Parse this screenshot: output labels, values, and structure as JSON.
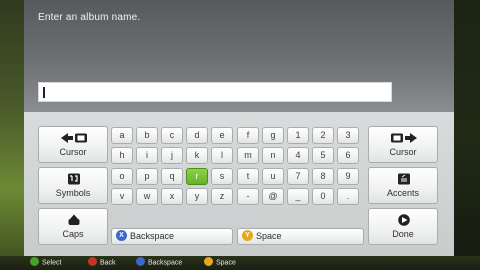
{
  "dialog": {
    "prompt": "Enter an album name.",
    "input_value": ""
  },
  "keyboard": {
    "rows": [
      [
        "a",
        "b",
        "c",
        "d",
        "e",
        "f",
        "g",
        "1",
        "2",
        "3"
      ],
      [
        "h",
        "i",
        "j",
        "k",
        "l",
        "m",
        "n",
        "4",
        "5",
        "6"
      ],
      [
        "o",
        "p",
        "q",
        "r",
        "s",
        "t",
        "u",
        "7",
        "8",
        "9"
      ],
      [
        "v",
        "w",
        "x",
        "y",
        "z",
        "-",
        "@",
        "_",
        "0",
        "."
      ]
    ],
    "selected_key": "r",
    "left_keys": {
      "cursor_left": "Cursor",
      "symbols": "Symbols",
      "caps": "Caps"
    },
    "right_keys": {
      "cursor_right": "Cursor",
      "accents": "Accents",
      "done": "Done"
    },
    "backspace": {
      "badge": "X",
      "label": "Backspace"
    },
    "space": {
      "badge": "Y",
      "label": "Space"
    }
  },
  "colors": {
    "selected_key": "#64b32a",
    "x_button": "#3a68c8",
    "y_button": "#e6a81c",
    "a_button": "#49a12b",
    "b_button": "#c63424"
  },
  "legend": {
    "select": "Select",
    "back": "Back",
    "backspace": "Backspace",
    "space": "Space"
  }
}
